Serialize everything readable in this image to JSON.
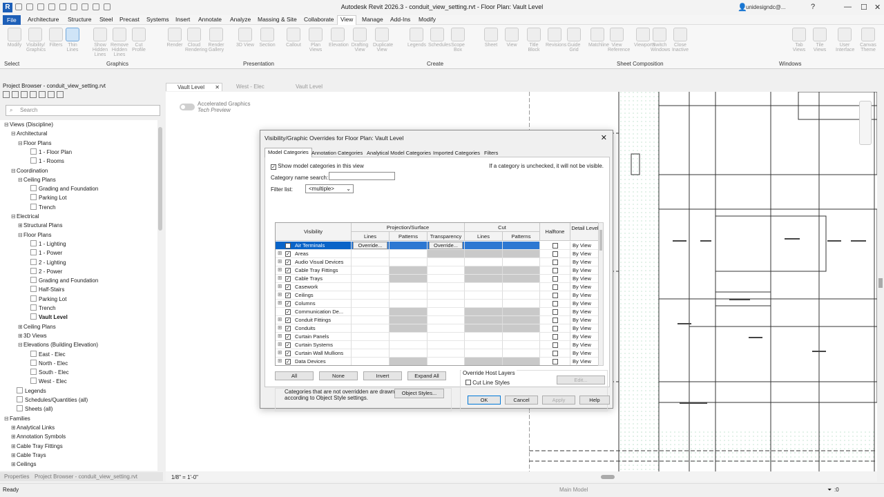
{
  "app": {
    "title": "Autodesk Revit 2026.3 - conduit_view_setting.rvt - Floor Plan: Vault Level",
    "user": "unidesigndc@..."
  },
  "menu": [
    "File",
    "Architecture",
    "Structure",
    "Steel",
    "Precast",
    "Systems",
    "Insert",
    "Annotate",
    "Analyze",
    "Massing & Site",
    "Collaborate",
    "View",
    "Manage",
    "Add-Ins",
    "Modify"
  ],
  "ribbon": {
    "tools": [
      "Modify",
      "Visibility/ Graphics",
      "Filters",
      "Thin Lines",
      "Show Hidden Lines",
      "Remove Hidden Lines",
      "Cut Profile",
      "Render",
      "Cloud Rendering",
      "Render Gallery",
      "3D View",
      "Section",
      "Callout",
      "Plan Views",
      "Elevation",
      "Drafting View",
      "Duplicate View",
      "Legends",
      "Schedules",
      "Scope Box",
      "Sheet",
      "View",
      "Title Block",
      "Revisions",
      "Guide Grid",
      "Matchline",
      "View Reference",
      "Viewports",
      "Switch Windows",
      "Close Inactive",
      "Tab Views",
      "Tile Views",
      "User Interface",
      "Canvas Theme"
    ],
    "panels": {
      "select": "Select",
      "graphics": "Graphics",
      "presentation": "Presentation",
      "create": "Create",
      "sheet": "Sheet Composition",
      "windows": "Windows"
    }
  },
  "project_browser": {
    "title": "Project Browser - conduit_view_setting.rvt",
    "search_placeholder": "Search",
    "tree": [
      "Views (Discipline)",
      "Architectural",
      "Floor Plans",
      "1 - Floor Plan",
      "1 - Rooms",
      "Coordination",
      "Ceiling Plans",
      "Grading and Foundation",
      "Parking Lot",
      "Trench",
      "Electrical",
      "Structural Plans",
      "Floor Plans",
      "1 - Lighting",
      "1 - Power",
      "2 - Lighting",
      "2 - Power",
      "Grading and Foundation",
      "Half-Stairs",
      "Parking Lot",
      "Trench",
      "Vault Level",
      "Ceiling Plans",
      "3D Views",
      "Elevations (Building Elevation)",
      "East - Elec",
      "North - Elec",
      "South - Elec",
      "West - Elec",
      "Legends",
      "Schedules/Quantities (all)",
      "Sheets (all)",
      "Families",
      "Analytical Links",
      "Annotation Symbols",
      "Cable Tray Fittings",
      "Cable Trays",
      "Ceilings"
    ],
    "tabs": [
      "Properties",
      "Project Browser - conduit_view_setting.rvt"
    ]
  },
  "view_tabs": [
    "Vault Level",
    "West - Elec",
    "Vault Level"
  ],
  "canvas": {
    "accel_line1": "Accelerated Graphics",
    "accel_line2": "Tech Preview"
  },
  "dialog": {
    "title": "Visibility/Graphic Overrides for Floor Plan: Vault Level",
    "tabs": [
      "Model Categories",
      "Annotation Categories",
      "Analytical Model Categories",
      "Imported Categories",
      "Filters"
    ],
    "show_label": "Show model categories in this view",
    "hint": "If a category is unchecked, it will not be visible.",
    "search_label": "Category name search:",
    "filter_label": "Filter list:",
    "filter_value": "<multiple>",
    "headers": {
      "visibility": "Visibility",
      "proj": "Projection/Surface",
      "cut": "Cut",
      "lines": "Lines",
      "patterns": "Patterns",
      "transparency": "Transparency",
      "halftone": "Halftone",
      "detail": "Detail Level"
    },
    "rows": [
      {
        "name": "Air Terminals",
        "exp": "",
        "lines": "Override...",
        "transp": "Override..."
      },
      {
        "name": "Areas",
        "exp": "⊞"
      },
      {
        "name": "Audio Visual Devices",
        "exp": "⊞"
      },
      {
        "name": "Cable Tray Fittings",
        "exp": "⊞"
      },
      {
        "name": "Cable Trays",
        "exp": "⊞"
      },
      {
        "name": "Casework",
        "exp": "⊞"
      },
      {
        "name": "Ceilings",
        "exp": "⊞"
      },
      {
        "name": "Columns",
        "exp": "⊞"
      },
      {
        "name": "Communication De...",
        "exp": ""
      },
      {
        "name": "Conduit Fittings",
        "exp": "⊞"
      },
      {
        "name": "Conduits",
        "exp": "⊞"
      },
      {
        "name": "Curtain Panels",
        "exp": "⊞"
      },
      {
        "name": "Curtain Systems",
        "exp": "⊞"
      },
      {
        "name": "Curtain Wall Mullions",
        "exp": "⊞"
      },
      {
        "name": "Data Devices",
        "exp": "⊞"
      }
    ],
    "detail_value": "By View",
    "buttons": {
      "all": "All",
      "none": "None",
      "invert": "Invert",
      "expand": "Expand All",
      "object_styles": "Object Styles...",
      "edit": "Edit...",
      "ok": "OK",
      "cancel": "Cancel",
      "apply": "Apply",
      "help": "Help"
    },
    "note": "Categories that are not overridden are drawn according to Object Style settings.",
    "host_layers": "Override Host Layers",
    "cut_line_styles": "Cut Line Styles"
  },
  "status": {
    "left": "Ready",
    "model": "Main Model",
    "scale": "1/8\" = 1'-0\"",
    "filter_count": ":0"
  }
}
